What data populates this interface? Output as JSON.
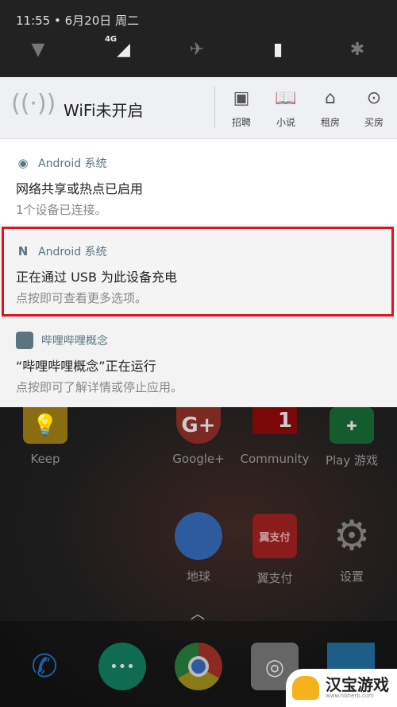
{
  "status": {
    "time": "11:55 • 6月20日 周二",
    "net_label": "4G"
  },
  "toolbar": {
    "wifi_title": "WiFi未开启",
    "buttons": [
      {
        "label": "招聘",
        "icon": "badge-icon"
      },
      {
        "label": "小说",
        "icon": "book-icon"
      },
      {
        "label": "租房",
        "icon": "house-icon"
      },
      {
        "label": "买房",
        "icon": "more-icon"
      }
    ]
  },
  "notifications": [
    {
      "app": "Android 系统",
      "title": "网络共享或热点已启用",
      "text": "1个设备已连接。",
      "icon": "hotspot-icon"
    },
    {
      "app": "Android 系统",
      "title": "正在通过 USB 为此设备充电",
      "text": "点按即可查看更多选项。",
      "icon": "android-n-icon",
      "highlighted": true,
      "highlight_color": "#e0121e"
    },
    {
      "app": "哔哩哔哩概念",
      "title": "“哔哩哔哩概念”正在运行",
      "text": "点按即可了解详情或停止应用。",
      "icon": "app-square-icon"
    }
  ],
  "home": {
    "apps": [
      {
        "label": "Keep",
        "badge": ""
      },
      {
        "label": "Google+",
        "badge": "G+"
      },
      {
        "label": "Community",
        "badge": "1"
      },
      {
        "label": "Play 游戏",
        "badge": ""
      },
      {
        "label": "地球",
        "badge": ""
      },
      {
        "label": "翼支付",
        "badge": "翼支付"
      },
      {
        "label": "设置",
        "badge": ""
      }
    ]
  },
  "watermark": {
    "title": "汉宝游戏",
    "url": "www.hbherb.com"
  }
}
